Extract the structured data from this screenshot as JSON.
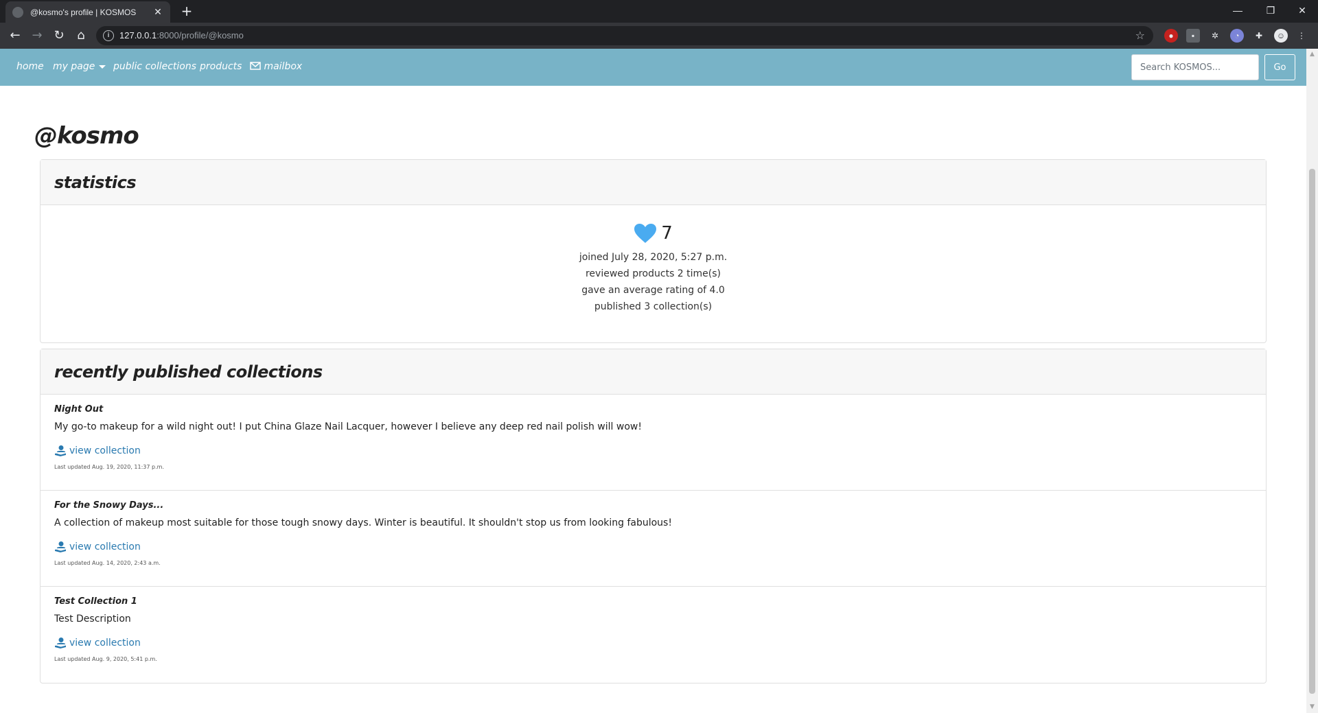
{
  "browser": {
    "tab_title": "@kosmo's profile | KOSMOS",
    "tab_close": "✕",
    "new_tab": "+",
    "url_host": "127.0.0.1",
    "url_rest": ":8000/profile/@kosmo",
    "window_controls": [
      "—",
      "❐",
      "✕"
    ]
  },
  "nav": {
    "home": "home",
    "my_page": "my page",
    "public_collections": "public collections",
    "products": "products",
    "mailbox": "mailbox",
    "search_placeholder": "Search KOSMOS...",
    "go": "Go"
  },
  "profile": {
    "username": "@kosmo",
    "statistics_title": "statistics",
    "likes": "7",
    "joined": "joined July 28, 2020, 5:27 p.m.",
    "reviewed": "reviewed products 2 time(s)",
    "avg_rating": "gave an average rating of 4.0",
    "published": "published 3 collection(s)"
  },
  "collections": {
    "title": "recently published collections",
    "view_label": "view collection",
    "items": [
      {
        "name": "Night Out",
        "description": "My go-to makeup for a wild night out! I put China Glaze Nail Lacquer, however I believe any deep red nail polish will wow!",
        "updated": "Last updated Aug. 19, 2020, 11:37 p.m."
      },
      {
        "name": "For the Snowy Days...",
        "description": "A collection of makeup most suitable for those tough snowy days. Winter is beautiful. It shouldn't stop us from looking fabulous!",
        "updated": "Last updated Aug. 14, 2020, 2:43 a.m."
      },
      {
        "name": "Test Collection 1",
        "description": "Test Description",
        "updated": "Last updated Aug. 9, 2020, 5:41 p.m."
      }
    ]
  },
  "colors": {
    "navbar": "#78b3c7",
    "heart": "#4aabf0",
    "link": "#2a7ab0"
  }
}
